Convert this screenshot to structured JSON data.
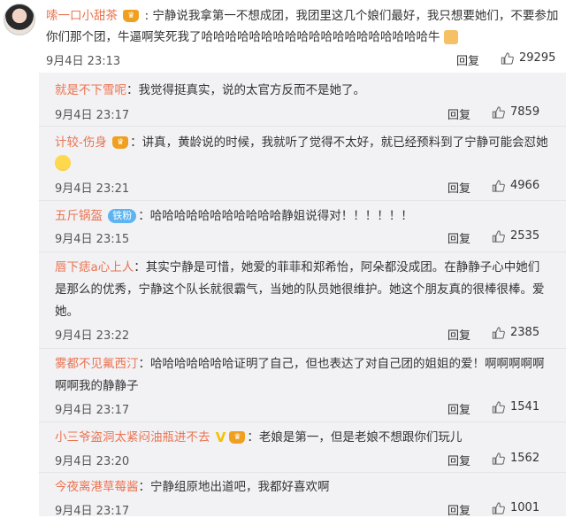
{
  "main_comment": {
    "author": "嗦一口小甜茶",
    "line1": ": 宁静说我拿第一不想成团，我团里这几个娘们最好，我只想要她们，不要参加",
    "line2": "你们那个团，牛逼啊笑死我了哈哈哈哈哈哈哈哈哈哈哈哈哈哈哈哈哈哈哈牛",
    "time": "9月4日 23:13",
    "reply_label": "回复",
    "likes": "29295"
  },
  "replies": [
    {
      "author": "就是不下雪呢",
      "badge": "",
      "lines": [
        "：我觉得挺真实，说的太官方反而不是她了。"
      ],
      "time": "9月4日 23:17",
      "reply_label": "回复",
      "likes": "7859"
    },
    {
      "author": "计较-伤身",
      "badge": "crown",
      "lines": [
        "：讲真，黄龄说的时候，我就听了觉得不太好，就已经预料到了宁静可能会怼她"
      ],
      "time": "9月4日 23:21",
      "reply_label": "回复",
      "likes": "4966"
    },
    {
      "author": "五斤锅盔",
      "badge": "铁粉",
      "lines": [
        "：哈哈哈哈哈哈哈哈哈哈哈静姐说得对！！！！！！"
      ],
      "time": "9月4日 23:15",
      "reply_label": "回复",
      "likes": "2535"
    },
    {
      "author": "唇下痣a心上人",
      "badge": "",
      "lines": [
        "：其实宁静是可惜，她爱的菲菲和郑希怡，阿朵都没成团。在静静子心中她们",
        "是那么的优秀，宁静这个队长就很霸气，当她的队员她很维护。她这个朋友真的很棒很棒。爱",
        "她。"
      ],
      "time": "9月4日 23:22",
      "reply_label": "回复",
      "likes": "2385"
    },
    {
      "author": "雾都不见氟西汀",
      "badge": "",
      "lines": [
        "：哈哈哈哈哈哈哈证明了自己，但也表达了对自己团的姐姐的爱！啊啊啊啊啊",
        "啊啊我的静静子"
      ],
      "time": "9月4日 23:17",
      "reply_label": "回复",
      "likes": "1541"
    },
    {
      "author": "小三爷盗洞太紧闷油瓶进不去",
      "badge": "v-crown",
      "lines": [
        "：老娘是第一，但是老娘不想跟你们玩儿"
      ],
      "time": "9月4日 23:20",
      "reply_label": "回复",
      "likes": "1562"
    },
    {
      "author": "今夜离港草莓酱",
      "badge": "",
      "lines": [
        "：宁静组原地出道吧，我都好喜欢啊"
      ],
      "time": "9月4日 23:17",
      "reply_label": "回复",
      "likes": "1001"
    }
  ],
  "icons": {
    "avatar": "user-avatar",
    "like": "thumbs-up-icon",
    "crown": "crown-badge-icon",
    "v": "v-icon",
    "emoji_thumb": "thumbs-up-emoji",
    "emoji_laugh": "laughing-emoji"
  },
  "colors": {
    "username": "#eb7350",
    "reply_bg": "#f2f2f5",
    "iron_tag": "#5db4f0"
  }
}
